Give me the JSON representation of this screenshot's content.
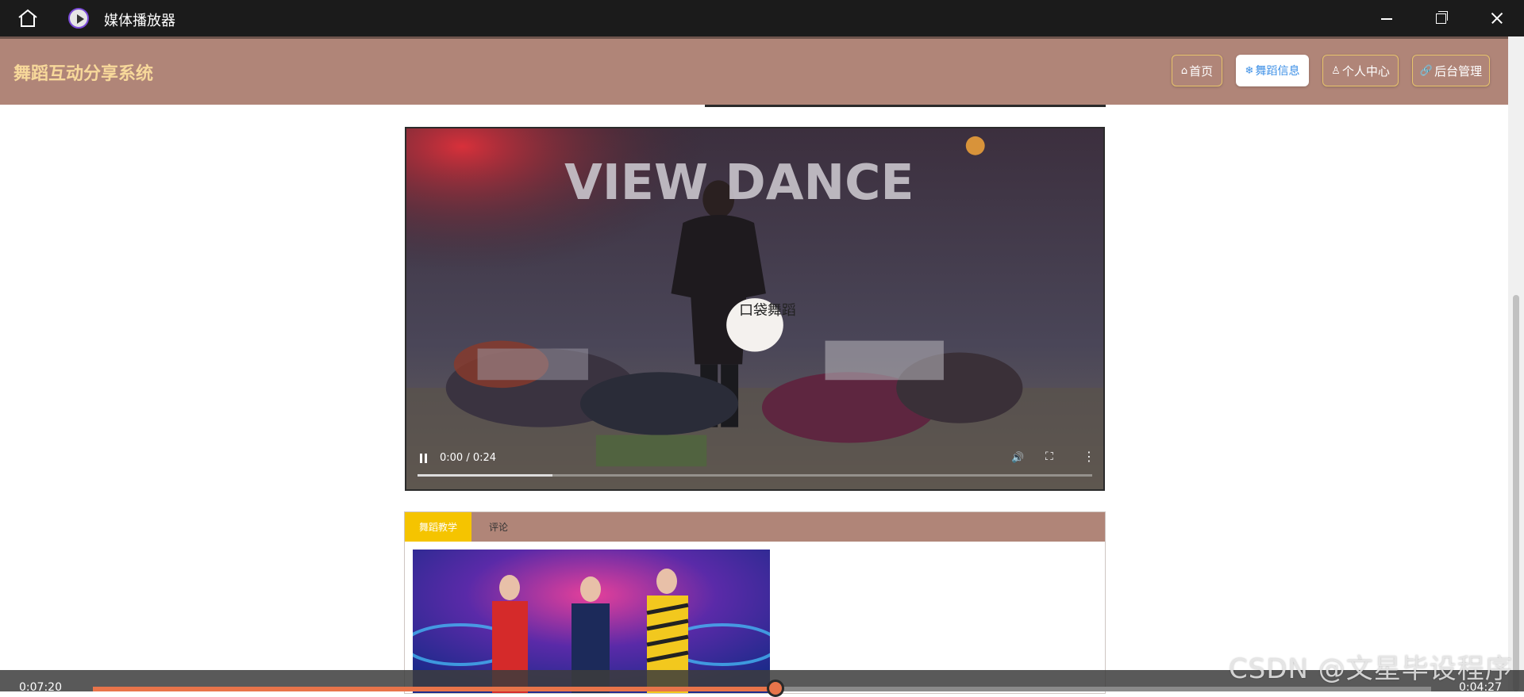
{
  "window": {
    "title": "媒体播放器",
    "icons": [
      "home-icon",
      "media-player-icon",
      "minimize-icon",
      "maximize-icon",
      "close-icon"
    ]
  },
  "header": {
    "site_title": "舞蹈互动分享系统",
    "nav": [
      {
        "icon": "⌂",
        "label": "首页",
        "active": false
      },
      {
        "icon": "❄",
        "label": "舞蹈信息",
        "active": true
      },
      {
        "icon": "♙",
        "label": "个人中心",
        "active": false
      },
      {
        "icon": "🔗",
        "label": "后台管理",
        "active": false
      }
    ]
  },
  "video": {
    "overlay_text": "VIEW DANCE",
    "logo_text": "口袋舞蹈",
    "time": "0:00 / 0:24",
    "progress": 0.2
  },
  "tabs": {
    "items": [
      "舞蹈教学",
      "评论"
    ],
    "active": "舞蹈教学"
  },
  "media_bar": {
    "elapsed": "0:07:20",
    "total": "0:04:27",
    "progress": 0.51
  },
  "watermark": "CSDN @文星毕设程序",
  "colors": {
    "header_bg": "#b08578",
    "site_title": "#f7d89a",
    "tab_active": "#f5c400",
    "active_nav_text": "#3a8ee6",
    "media_progress": "#e8744a"
  }
}
